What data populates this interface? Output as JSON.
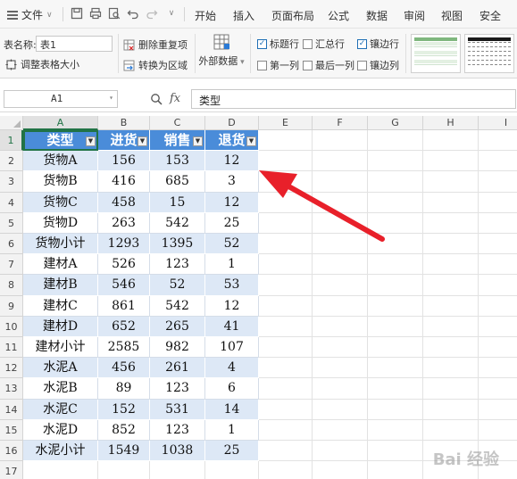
{
  "menubar": {
    "file_label": "文件",
    "tabs": [
      "开始",
      "插入",
      "页面布局",
      "公式",
      "数据",
      "审阅",
      "视图",
      "安全"
    ]
  },
  "ribbon": {
    "table_name_label": "表名称:",
    "table_name_value": "表1",
    "resize_label": "调整表格大小",
    "remove_dup_label": "删除重复项",
    "convert_label": "转换为区域",
    "external_label": "外部数据",
    "options": [
      {
        "label": "标题行",
        "checked": true
      },
      {
        "label": "汇总行",
        "checked": false
      },
      {
        "label": "镶边行",
        "checked": true
      },
      {
        "label": "第一列",
        "checked": false
      },
      {
        "label": "最后一列",
        "checked": false
      },
      {
        "label": "镶边列",
        "checked": false
      }
    ]
  },
  "formula_bar": {
    "cell_ref": "A1",
    "fx": "fx",
    "content": "类型"
  },
  "columns": [
    "A",
    "B",
    "C",
    "D",
    "E",
    "F",
    "G",
    "H",
    "I"
  ],
  "rows": [
    "1",
    "2",
    "3",
    "4",
    "5",
    "6",
    "7",
    "8",
    "9",
    "10",
    "11",
    "12",
    "13",
    "14",
    "15",
    "16",
    "17"
  ],
  "table": {
    "headers": [
      "类型",
      "进货",
      "销售",
      "退货"
    ],
    "rows": [
      [
        "货物A",
        "156",
        "153",
        "12"
      ],
      [
        "货物B",
        "416",
        "685",
        "3"
      ],
      [
        "货物C",
        "458",
        "15",
        "12"
      ],
      [
        "货物D",
        "263",
        "542",
        "25"
      ],
      [
        "货物小计",
        "1293",
        "1395",
        "52"
      ],
      [
        "建材A",
        "526",
        "123",
        "1"
      ],
      [
        "建材B",
        "546",
        "52",
        "53"
      ],
      [
        "建材C",
        "861",
        "542",
        "12"
      ],
      [
        "建材D",
        "652",
        "265",
        "41"
      ],
      [
        "建材小计",
        "2585",
        "982",
        "107"
      ],
      [
        "水泥A",
        "456",
        "261",
        "4"
      ],
      [
        "水泥B",
        "89",
        "123",
        "6"
      ],
      [
        "水泥C",
        "152",
        "531",
        "14"
      ],
      [
        "水泥D",
        "852",
        "123",
        "1"
      ],
      [
        "水泥小计",
        "1549",
        "1038",
        "25"
      ]
    ]
  },
  "colors": {
    "header_fill": "#4a8cd9",
    "band_fill": "#dde8f6",
    "arrow": "#e8202a"
  },
  "watermark": "Bai 经验"
}
